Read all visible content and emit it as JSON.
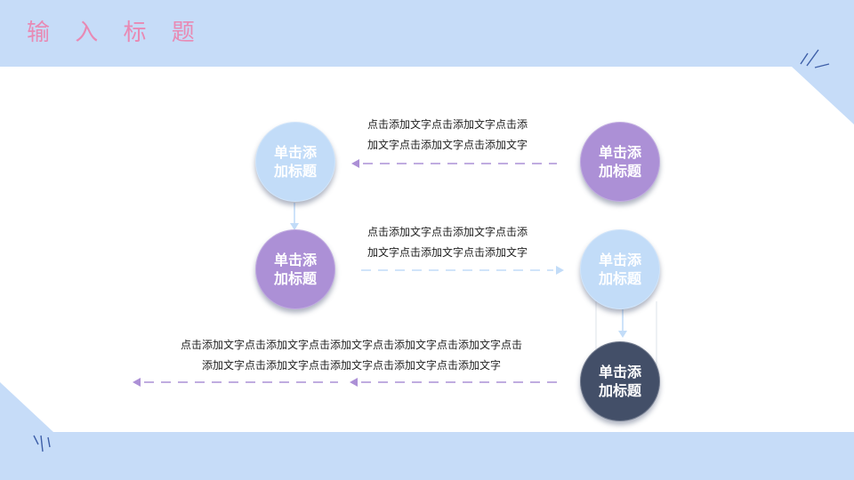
{
  "title": "输 入 标 题",
  "colors": {
    "background_band": "#c6dcf8",
    "panel": "#ffffff",
    "title": "#e88ab4",
    "light_blue": "#c2dcf8",
    "purple": "#ac90d6",
    "navy": "#434f68"
  },
  "nodes": [
    {
      "label": "单击添加标题",
      "color": "light_blue"
    },
    {
      "label": "单击添加标题",
      "color": "purple"
    },
    {
      "label": "单击添加标题",
      "color": "purple"
    },
    {
      "label": "单击添加标题",
      "color": "light_blue"
    },
    {
      "label": "单击添加标题",
      "color": "navy"
    }
  ],
  "texts": [
    {
      "line1": "点击添加文字点击添加文字点击添",
      "line2": "加文字点击添加文字点击添加文字"
    },
    {
      "line1": "点击添加文字点击添加文字点击添",
      "line2": "加文字点击添加文字点击添加文字"
    },
    {
      "line1": "点击添加文字点击添加文字点击添加文字点击添加文字点击添加文字点击",
      "line2": "添加文字点击添加文字点击添加文字点击添加文字点击添加文字"
    }
  ]
}
